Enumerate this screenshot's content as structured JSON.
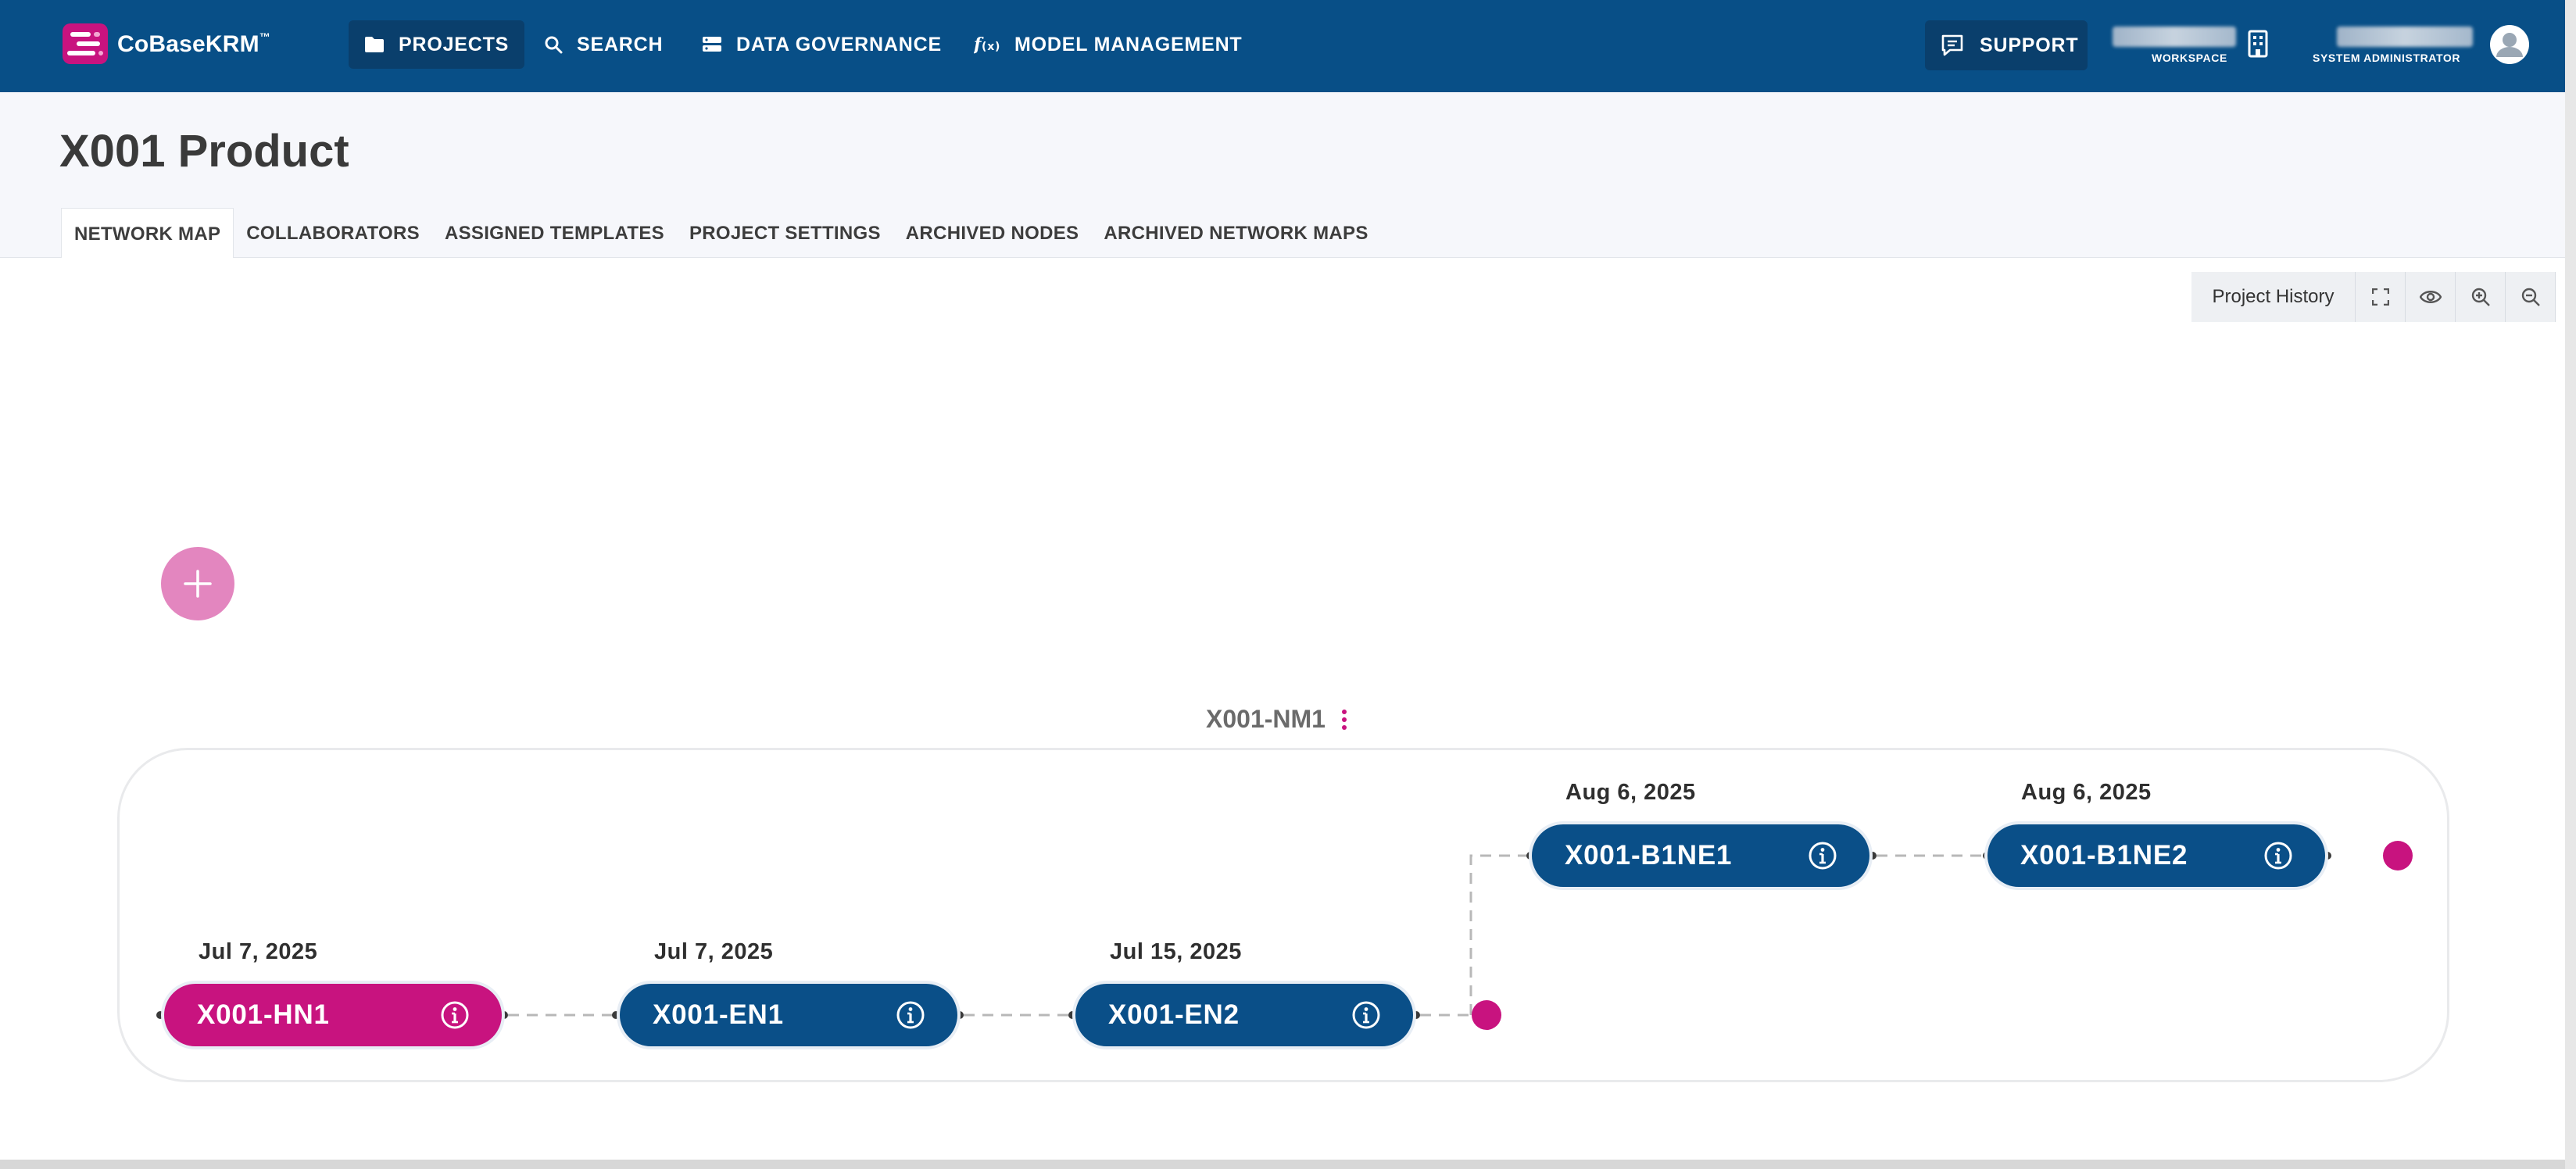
{
  "app": {
    "brand": "CoBaseKRM",
    "trademark": "™"
  },
  "nav": {
    "items": [
      {
        "label": "PROJECTS",
        "icon": "folder-icon"
      },
      {
        "label": "SEARCH",
        "icon": "search-icon"
      },
      {
        "label": "DATA GOVERNANCE",
        "icon": "database-icon"
      },
      {
        "label": "MODEL MANAGEMENT",
        "icon": "function-icon"
      }
    ],
    "support_label": "SUPPORT",
    "workspace_label": "WORKSPACE",
    "user_role": "SYSTEM ADMINISTRATOR"
  },
  "page": {
    "title": "X001 Product",
    "tabs": [
      "NETWORK MAP",
      "COLLABORATORS",
      "ASSIGNED TEMPLATES",
      "PROJECT SETTINGS",
      "ARCHIVED NODES",
      "ARCHIVED NETWORK MAPS"
    ]
  },
  "toolbar": {
    "history_label": "Project History"
  },
  "network_map": {
    "title": "X001-NM1",
    "nodes": [
      {
        "label": "X001-HN1",
        "date": "Jul 7, 2025",
        "type": "head"
      },
      {
        "label": "X001-EN1",
        "date": "Jul 7, 2025",
        "type": "entity"
      },
      {
        "label": "X001-EN2",
        "date": "Jul 15, 2025",
        "type": "entity"
      },
      {
        "label": "X001-B1NE1",
        "date": "Aug 6, 2025",
        "type": "entity"
      },
      {
        "label": "X001-B1NE2",
        "date": "Aug 6, 2025",
        "type": "entity"
      }
    ]
  },
  "colors": {
    "nav_bg": "#084f87",
    "accent_pink": "#c8137f",
    "node_blue": "#0a4f88",
    "add_button": "#e386bf"
  }
}
